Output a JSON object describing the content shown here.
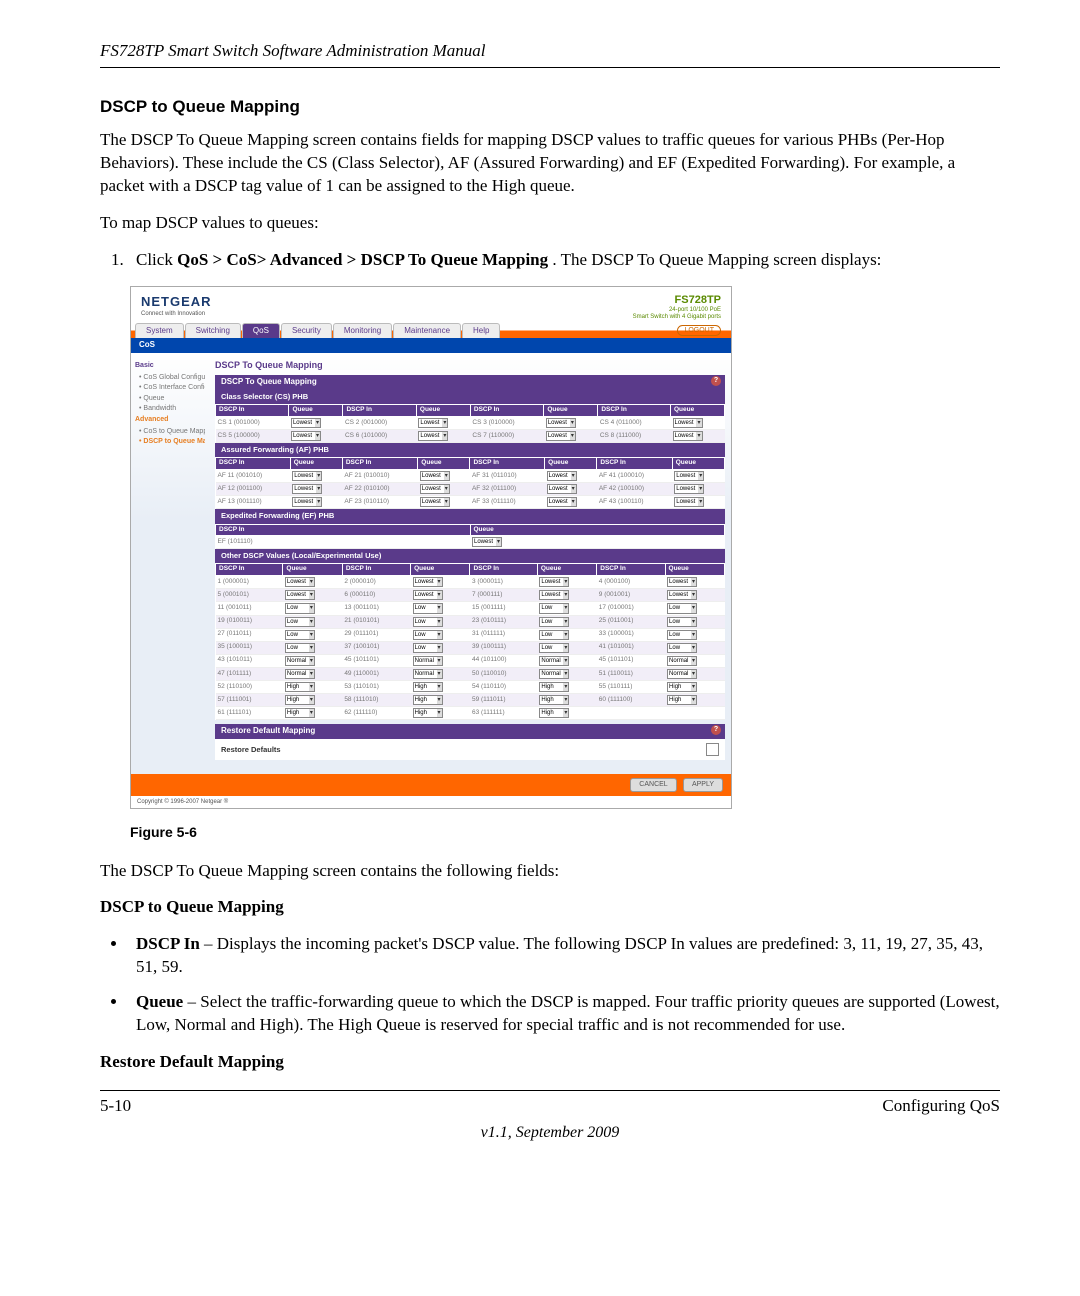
{
  "header": "FS728TP Smart Switch Software Administration Manual",
  "section_title": "DSCP to Queue Mapping",
  "intro": "The DSCP To Queue Mapping screen contains fields for mapping DSCP values to traffic queues for various PHBs (Per-Hop Behaviors). These include the CS (Class Selector), AF (Assured Forwarding) and EF (Expedited Forwarding). For example, a packet with a DSCP tag value of 1 can be assigned to the High queue.",
  "lead_in": "To map DSCP values to queues:",
  "step1_prefix": "Click ",
  "step1_bold": "QoS > CoS> Advanced > DSCP To Queue Mapping",
  "step1_suffix": ". The DSCP To Queue Mapping screen displays:",
  "figure_caption": "Figure 5-6",
  "after_figure": "The DSCP To Queue Mapping screen contains the following fields:",
  "field_group_title": "DSCP to Queue Mapping",
  "bullet1_term": "DSCP In",
  "bullet1_rest": " – Displays the incoming packet's DSCP value. The following DSCP In values are predefined: 3, 11, 19, 27, 35, 43, 51, 59.",
  "bullet2_term": "Queue",
  "bullet2_rest": " – Select the traffic-forwarding queue to which the DSCP is mapped. Four traffic priority queues are supported (Lowest, Low, Normal and High). The High Queue is reserved for special traffic and is not recommended for use.",
  "restore_heading": "Restore Default Mapping",
  "footer_left": "5-10",
  "footer_right": "Configuring QoS",
  "footer_version": "v1.1, September 2009",
  "screenshot": {
    "brand": "NETGEAR",
    "brand_sub": "Connect with Innovation",
    "model": "FS728TP",
    "model_sub1": "24-port 10/100 PoE",
    "model_sub2": "Smart Switch with 4 Gigabit ports",
    "tabs": [
      "System",
      "Switching",
      "QoS",
      "Security",
      "Monitoring",
      "Maintenance",
      "Help"
    ],
    "active_tab": "QoS",
    "logout": "LOGOUT",
    "subnav": "CoS",
    "sidebar": {
      "head1": "Basic",
      "items1": [
        "• CoS Global Configuration",
        "• CoS Interface Configuration",
        "• Queue",
        "• Bandwidth"
      ],
      "head2": "Advanced",
      "items2": [
        "• CoS to Queue Mapping",
        "• DSCP to Queue Mapping"
      ]
    },
    "main_title": "DSCP To Queue Mapping",
    "panel_title": "DSCP To Queue Mapping",
    "cs_title": "Class Selector (CS) PHB",
    "cs_rows": [
      [
        {
          "label": "CS 1 (001000)",
          "q": "Lowest"
        },
        {
          "label": "CS 2 (001000)",
          "q": "Lowest"
        },
        {
          "label": "CS 3 (010000)",
          "q": "Lowest"
        },
        {
          "label": "CS 4 (011000)",
          "q": "Lowest"
        }
      ],
      [
        {
          "label": "CS 5 (100000)",
          "q": "Lowest"
        },
        {
          "label": "CS 6 (101000)",
          "q": "Lowest"
        },
        {
          "label": "CS 7 (110000)",
          "q": "Lowest"
        },
        {
          "label": "CS 8 (111000)",
          "q": "Lowest"
        }
      ]
    ],
    "af_title": "Assured Forwarding (AF) PHB",
    "af_rows": [
      [
        {
          "label": "AF 11 (001010)",
          "q": "Lowest"
        },
        {
          "label": "AF 21 (010010)",
          "q": "Lowest"
        },
        {
          "label": "AF 31 (011010)",
          "q": "Lowest"
        },
        {
          "label": "AF 41 (100010)",
          "q": "Lowest"
        }
      ],
      [
        {
          "label": "AF 12 (001100)",
          "q": "Lowest"
        },
        {
          "label": "AF 22 (010100)",
          "q": "Lowest"
        },
        {
          "label": "AF 32 (011100)",
          "q": "Lowest"
        },
        {
          "label": "AF 42 (100100)",
          "q": "Lowest"
        }
      ],
      [
        {
          "label": "AF 13 (001110)",
          "q": "Lowest"
        },
        {
          "label": "AF 23 (010110)",
          "q": "Lowest"
        },
        {
          "label": "AF 33 (011110)",
          "q": "Lowest"
        },
        {
          "label": "AF 43 (100110)",
          "q": "Lowest"
        }
      ]
    ],
    "ef_title": "Expedited Forwarding (EF) PHB",
    "ef_row": {
      "label": "EF (101110)",
      "q": "Lowest"
    },
    "other_title": "Other DSCP Values (Local/Experimental Use)",
    "other_rows": [
      [
        {
          "label": "1 (000001)",
          "q": "Lowest"
        },
        {
          "label": "2 (000010)",
          "q": "Lowest"
        },
        {
          "label": "3 (000011)",
          "q": "Lowest"
        },
        {
          "label": "4 (000100)",
          "q": "Lowest"
        }
      ],
      [
        {
          "label": "5 (000101)",
          "q": "Lowest"
        },
        {
          "label": "6 (000110)",
          "q": "Lowest"
        },
        {
          "label": "7 (000111)",
          "q": "Lowest"
        },
        {
          "label": "9 (001001)",
          "q": "Lowest"
        }
      ],
      [
        {
          "label": "11 (001011)",
          "q": "Low"
        },
        {
          "label": "13 (001101)",
          "q": "Low"
        },
        {
          "label": "15 (001111)",
          "q": "Low"
        },
        {
          "label": "17 (010001)",
          "q": "Low"
        }
      ],
      [
        {
          "label": "19 (010011)",
          "q": "Low"
        },
        {
          "label": "21 (010101)",
          "q": "Low"
        },
        {
          "label": "23 (010111)",
          "q": "Low"
        },
        {
          "label": "25 (011001)",
          "q": "Low"
        }
      ],
      [
        {
          "label": "27 (011011)",
          "q": "Low"
        },
        {
          "label": "29 (011101)",
          "q": "Low"
        },
        {
          "label": "31 (011111)",
          "q": "Low"
        },
        {
          "label": "33 (100001)",
          "q": "Low"
        }
      ],
      [
        {
          "label": "35 (100011)",
          "q": "Low"
        },
        {
          "label": "37 (100101)",
          "q": "Low"
        },
        {
          "label": "39 (100111)",
          "q": "Low"
        },
        {
          "label": "41 (101001)",
          "q": "Low"
        }
      ],
      [
        {
          "label": "43 (101011)",
          "q": "Normal"
        },
        {
          "label": "45 (101101)",
          "q": "Normal"
        },
        {
          "label": "44 (101100)",
          "q": "Normal"
        },
        {
          "label": "45 (101101)",
          "q": "Normal"
        }
      ],
      [
        {
          "label": "47 (101111)",
          "q": "Normal"
        },
        {
          "label": "49 (110001)",
          "q": "Normal"
        },
        {
          "label": "50 (110010)",
          "q": "Normal"
        },
        {
          "label": "51 (110011)",
          "q": "Normal"
        }
      ],
      [
        {
          "label": "52 (110100)",
          "q": "High"
        },
        {
          "label": "53 (110101)",
          "q": "High"
        },
        {
          "label": "54 (110110)",
          "q": "High"
        },
        {
          "label": "55 (110111)",
          "q": "High"
        }
      ],
      [
        {
          "label": "57 (111001)",
          "q": "High"
        },
        {
          "label": "58 (111010)",
          "q": "High"
        },
        {
          "label": "59 (111011)",
          "q": "High"
        },
        {
          "label": "60 (111100)",
          "q": "High"
        }
      ],
      [
        {
          "label": "61 (111101)",
          "q": "High"
        },
        {
          "label": "62 (111110)",
          "q": "High"
        },
        {
          "label": "63 (111111)",
          "q": "High"
        }
      ]
    ],
    "restore_title": "Restore Default Mapping",
    "restore_label": "Restore Defaults",
    "cancel": "CANCEL",
    "apply": "APPLY",
    "copyright": "Copyright © 1996-2007 Netgear ®"
  }
}
